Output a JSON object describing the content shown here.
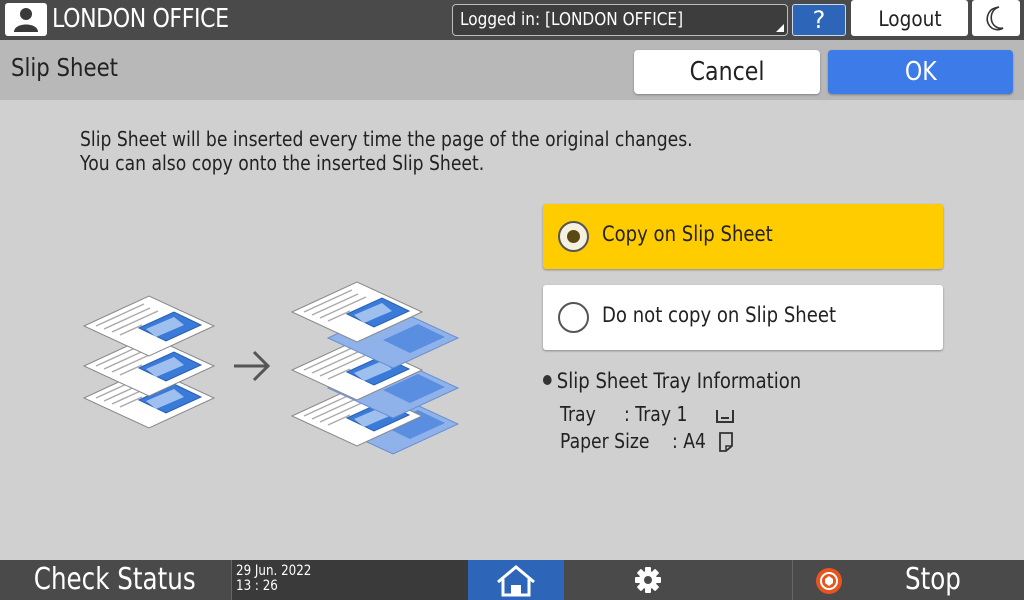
{
  "header": {
    "office_name": "LONDON OFFICE",
    "login_status": "Logged in: [LONDON OFFICE]",
    "help_label": "?",
    "logout_label": "Logout"
  },
  "titlebar": {
    "title": "Slip Sheet",
    "cancel_label": "Cancel",
    "ok_label": "OK"
  },
  "description": {
    "line1": "Slip Sheet will be inserted every time the page of the original changes.",
    "line2": "You can also copy onto the inserted Slip Sheet."
  },
  "options": [
    {
      "label": "Copy on Slip Sheet",
      "selected": true
    },
    {
      "label": "Do not copy on Slip Sheet",
      "selected": false
    }
  ],
  "tray_info": {
    "title": "Slip Sheet Tray Information",
    "tray_label": "Tray",
    "tray_value": ": Tray 1",
    "paper_size_label": "Paper Size",
    "paper_size_value": ": A4"
  },
  "footer": {
    "check_status_label": "Check Status",
    "date": "29 Jun. 2022",
    "time": "13 : 26",
    "stop_label": "Stop"
  },
  "colors": {
    "selected_option": "#ffcc00",
    "ok_button": "#3d7be8",
    "help_button": "#2d65b8",
    "home_button": "#2d65b8",
    "stop_icon": "#e8541e",
    "illustration_blue": "#3a7ad8"
  },
  "icons": {
    "user": "user-icon",
    "moon": "moon-icon",
    "home": "home-icon",
    "settings": "gear-icon",
    "stop": "stop-icon",
    "tray": "tray-icon",
    "paper": "paper-icon",
    "arrow": "arrow-right-icon"
  }
}
